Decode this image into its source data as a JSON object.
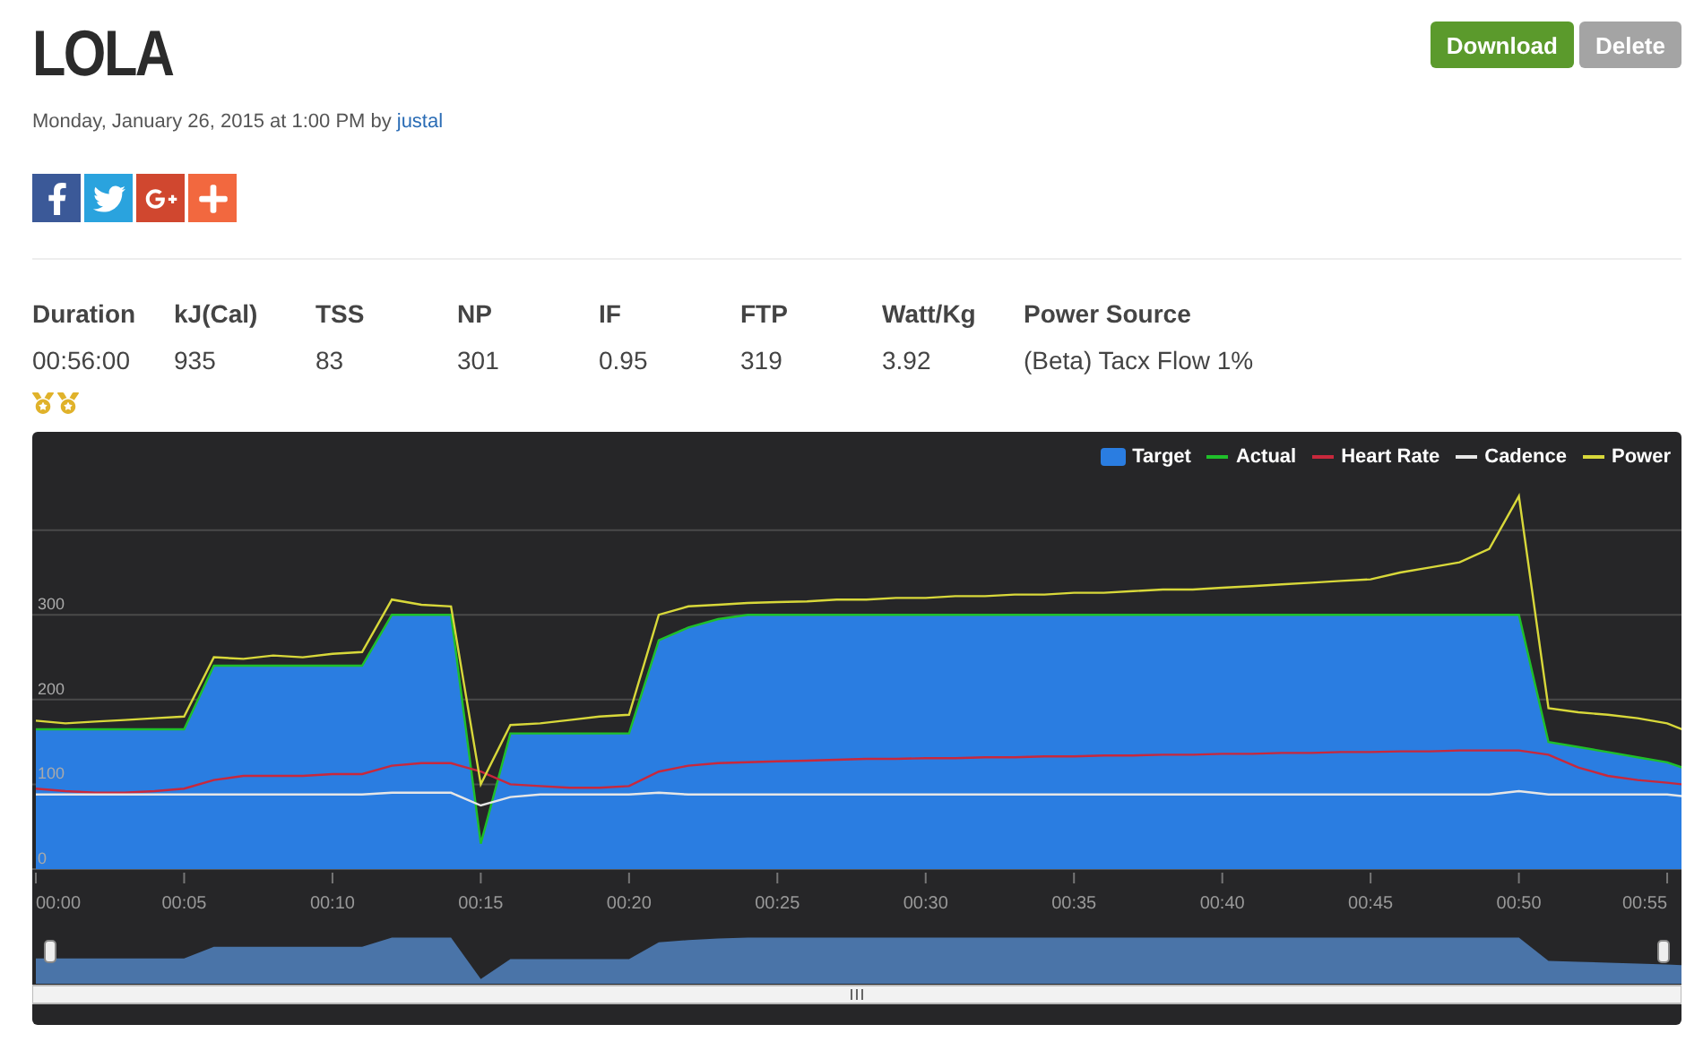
{
  "title": "LOLA",
  "actions": [
    {
      "label": "Download",
      "kind": "primary"
    },
    {
      "label": "Delete",
      "kind": "secondary"
    }
  ],
  "meta": {
    "date": "Monday, January 26, 2015 at 1:00 PM by",
    "author": "justal"
  },
  "share": [
    {
      "kind": "facebook"
    },
    {
      "kind": "twitter"
    },
    {
      "kind": "googleplus"
    },
    {
      "kind": "more"
    }
  ],
  "stats": [
    {
      "label": "Duration",
      "value": "00:56:00"
    },
    {
      "label": "kJ(Cal)",
      "value": "935"
    },
    {
      "label": "TSS",
      "value": "83"
    },
    {
      "label": "NP",
      "value": "301"
    },
    {
      "label": "IF",
      "value": "0.95"
    },
    {
      "label": "FTP",
      "value": "319"
    },
    {
      "label": "Watt/Kg",
      "value": "3.92"
    },
    {
      "label": "Power Source",
      "value": "(Beta) Tacx Flow 1%"
    }
  ],
  "medals": [
    {
      "kind": "medal"
    },
    {
      "kind": "medal"
    }
  ],
  "chart": {
    "chart_data": {
      "type": "line",
      "ylim": [
        0,
        516
      ],
      "grid": true,
      "legend": true,
      "xlim": [
        0,
        55.5
      ],
      "yticks": [
        0,
        100,
        200,
        300
      ],
      "xticks": [
        {
          "value": 0,
          "label": "00:00"
        },
        {
          "value": 5,
          "label": "00:05"
        },
        {
          "value": 10,
          "label": "00:10"
        },
        {
          "value": 15,
          "label": "00:15"
        },
        {
          "value": 20,
          "label": "00:20"
        },
        {
          "value": 25,
          "label": "00:25"
        },
        {
          "value": 30,
          "label": "00:30"
        },
        {
          "value": 35,
          "label": "00:35"
        },
        {
          "value": 40,
          "label": "00:40"
        },
        {
          "value": 45,
          "label": "00:45"
        },
        {
          "value": 50,
          "label": "00:50"
        },
        {
          "value": 55,
          "label": "00:55"
        }
      ],
      "x": [
        0,
        1,
        2,
        3,
        4,
        5,
        6,
        7,
        8,
        9,
        10,
        11,
        12,
        13,
        14,
        15,
        16,
        17,
        18,
        19,
        20,
        21,
        22,
        23,
        24,
        25,
        26,
        27,
        28,
        29,
        30,
        31,
        32,
        33,
        34,
        35,
        36,
        37,
        38,
        39,
        40,
        41,
        42,
        43,
        44,
        45,
        46,
        47,
        48,
        49,
        50,
        51,
        52,
        53,
        54,
        55,
        55.5
      ],
      "series": [
        {
          "name": "Target",
          "type": "area",
          "color": "#2a7de1",
          "values": [
            165,
            165,
            165,
            165,
            165,
            165,
            240,
            240,
            240,
            240,
            240,
            240,
            300,
            300,
            300,
            30,
            160,
            160,
            160,
            160,
            160,
            270,
            285,
            295,
            300,
            300,
            300,
            300,
            300,
            300,
            300,
            300,
            300,
            300,
            300,
            300,
            300,
            300,
            300,
            300,
            300,
            300,
            300,
            300,
            300,
            300,
            300,
            300,
            300,
            300,
            300,
            150,
            144,
            138,
            132,
            126,
            120
          ]
        },
        {
          "name": "Actual",
          "color": "#1fbf2a",
          "values": [
            165,
            165,
            165,
            165,
            165,
            165,
            240,
            240,
            240,
            240,
            240,
            240,
            300,
            300,
            300,
            30,
            160,
            160,
            160,
            160,
            160,
            270,
            285,
            295,
            300,
            300,
            300,
            300,
            300,
            300,
            300,
            300,
            300,
            300,
            300,
            300,
            300,
            300,
            300,
            300,
            300,
            300,
            300,
            300,
            300,
            300,
            300,
            300,
            300,
            300,
            300,
            150,
            144,
            138,
            132,
            126,
            120
          ]
        },
        {
          "name": "Heart Rate",
          "color": "#c8283c",
          "values": [
            95,
            92,
            90,
            90,
            92,
            95,
            105,
            110,
            110,
            110,
            112,
            112,
            122,
            125,
            125,
            115,
            100,
            98,
            96,
            96,
            98,
            115,
            122,
            125,
            126,
            127,
            128,
            129,
            130,
            130,
            131,
            131,
            132,
            132,
            133,
            133,
            134,
            134,
            135,
            135,
            136,
            136,
            137,
            137,
            138,
            138,
            139,
            139,
            140,
            140,
            140,
            135,
            120,
            110,
            105,
            102,
            100
          ]
        },
        {
          "name": "Cadence",
          "color": "#e6e6e6",
          "values": [
            88,
            88,
            88,
            88,
            88,
            88,
            88,
            88,
            88,
            88,
            88,
            88,
            90,
            90,
            90,
            75,
            85,
            88,
            88,
            88,
            88,
            90,
            88,
            88,
            88,
            88,
            88,
            88,
            88,
            88,
            88,
            88,
            88,
            88,
            88,
            88,
            88,
            88,
            88,
            88,
            88,
            88,
            88,
            88,
            88,
            88,
            88,
            88,
            88,
            88,
            92,
            88,
            88,
            88,
            88,
            88,
            86
          ]
        },
        {
          "name": "Power",
          "color": "#d8d83a",
          "values": [
            175,
            172,
            174,
            176,
            178,
            180,
            250,
            248,
            252,
            250,
            254,
            256,
            318,
            312,
            310,
            100,
            170,
            172,
            176,
            180,
            182,
            300,
            310,
            312,
            314,
            315,
            316,
            318,
            318,
            320,
            320,
            322,
            322,
            324,
            324,
            326,
            326,
            328,
            330,
            330,
            332,
            334,
            336,
            338,
            340,
            342,
            350,
            356,
            362,
            378,
            440,
            190,
            185,
            182,
            178,
            172,
            165
          ]
        }
      ]
    }
  }
}
